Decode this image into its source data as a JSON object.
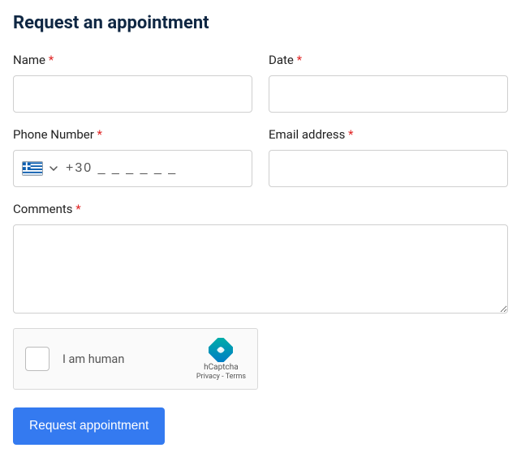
{
  "title": "Request an appointment",
  "required_marker": "*",
  "fields": {
    "name": {
      "label": "Name ",
      "value": ""
    },
    "date": {
      "label": "Date ",
      "value": ""
    },
    "phone": {
      "label": "Phone Number ",
      "value": "",
      "placeholder": "+30 _ _ _ _ _ _",
      "country_code": "+30",
      "flag_country": "Greece"
    },
    "email": {
      "label": "Email address ",
      "value": ""
    },
    "comments": {
      "label": "Comments ",
      "value": ""
    }
  },
  "captcha": {
    "text": "I am human",
    "brand": "hCaptcha",
    "links": "Privacy - Terms"
  },
  "submit_label": "Request appointment",
  "colors": {
    "accent": "#347af0",
    "title": "#0f2743",
    "required": "#e02424"
  }
}
